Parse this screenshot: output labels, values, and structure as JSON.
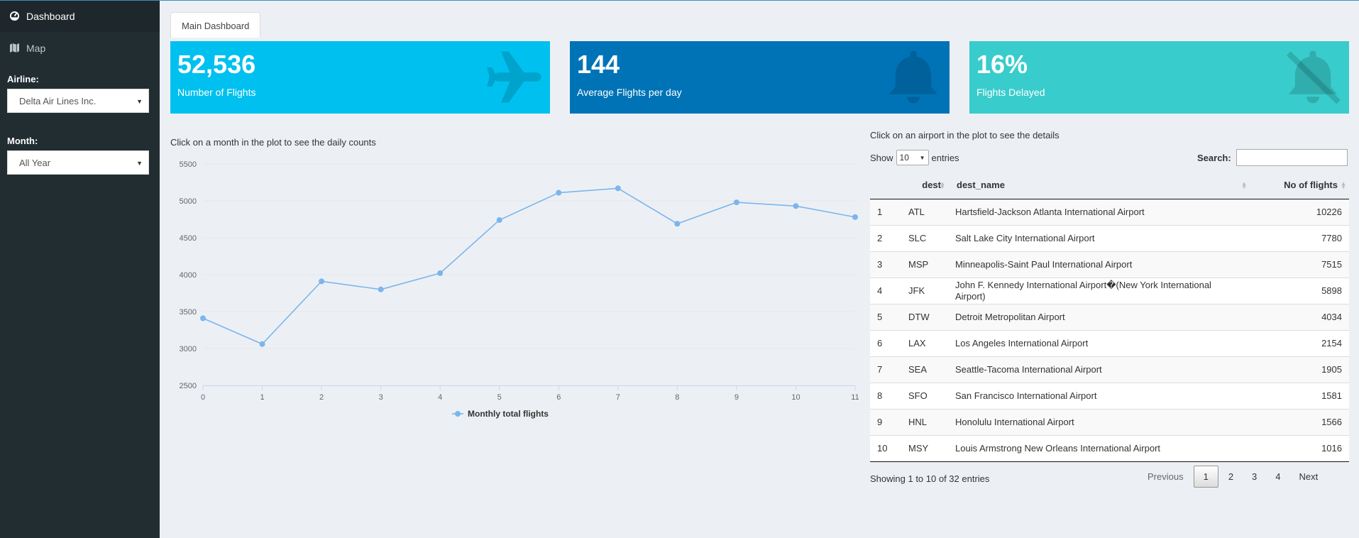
{
  "sidebar": {
    "menu": [
      {
        "label": "Dashboard",
        "icon": "dashboard-icon"
      },
      {
        "label": "Map",
        "icon": "map-icon"
      }
    ],
    "airline_label": "Airline:",
    "airline_value": "Delta Air Lines Inc.",
    "month_label": "Month:",
    "month_value": "All Year"
  },
  "tabs": [
    {
      "label": "Main Dashboard"
    }
  ],
  "value_boxes": [
    {
      "value": "52,536",
      "subtitle": "Number of Flights",
      "color": "#00c0ef",
      "icon": "plane-icon"
    },
    {
      "value": "144",
      "subtitle": "Average Flights per day",
      "color": "#0073b7",
      "icon": "bell-icon"
    },
    {
      "value": "16%",
      "subtitle": "Flights Delayed",
      "color": "#39cccc",
      "icon": "bell-slash-icon"
    }
  ],
  "plot": {
    "caption": "Click on a month in the plot to see the daily counts"
  },
  "chart_data": {
    "type": "line",
    "x": [
      0,
      1,
      2,
      3,
      4,
      5,
      6,
      7,
      8,
      9,
      10,
      11
    ],
    "series": [
      {
        "name": "Monthly total flights",
        "values": [
          3410,
          3060,
          3910,
          3800,
          4020,
          4740,
          5110,
          5170,
          4690,
          4980,
          4930,
          4780
        ],
        "color": "#7cb5ec"
      }
    ],
    "ylim": [
      2500,
      5500
    ],
    "yticks": [
      2500,
      3000,
      3500,
      4000,
      4500,
      5000,
      5500
    ],
    "grid": true,
    "legend": "bottom"
  },
  "table": {
    "caption": "Click on an airport in the plot to see the details",
    "show_label": "Show",
    "show_value": "10",
    "entries_label": "entries",
    "search_label": "Search:",
    "search_value": "",
    "columns": [
      "",
      "dest",
      "dest_name",
      "No of flights"
    ],
    "rows": [
      [
        "1",
        "ATL",
        "Hartsfield-Jackson Atlanta International Airport",
        "10226"
      ],
      [
        "2",
        "SLC",
        "Salt Lake City International Airport",
        "7780"
      ],
      [
        "3",
        "MSP",
        "Minneapolis-Saint Paul International Airport",
        "7515"
      ],
      [
        "4",
        "JFK",
        "John F. Kennedy International Airport�(New York International Airport)",
        "5898"
      ],
      [
        "5",
        "DTW",
        "Detroit Metropolitan Airport",
        "4034"
      ],
      [
        "6",
        "LAX",
        "Los Angeles International Airport",
        "2154"
      ],
      [
        "7",
        "SEA",
        "Seattle-Tacoma International Airport",
        "1905"
      ],
      [
        "8",
        "SFO",
        "San Francisco International Airport",
        "1581"
      ],
      [
        "9",
        "HNL",
        "Honolulu International Airport",
        "1566"
      ],
      [
        "10",
        "MSY",
        "Louis Armstrong New Orleans International Airport",
        "1016"
      ]
    ],
    "info": "Showing 1 to 10 of 32 entries",
    "pager": {
      "previous": "Previous",
      "pages": [
        "1",
        "2",
        "3",
        "4"
      ],
      "current": "1",
      "next": "Next"
    }
  }
}
